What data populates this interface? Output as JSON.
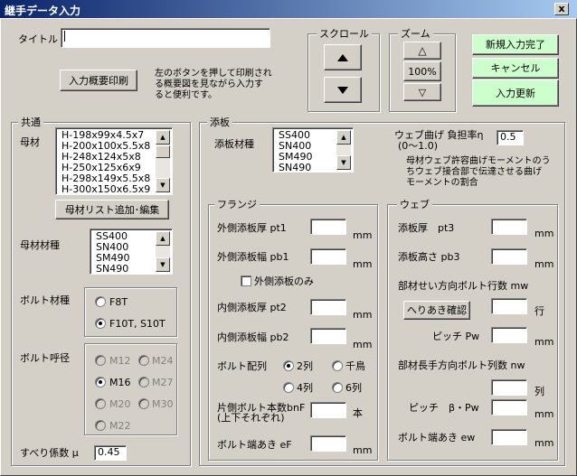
{
  "window": {
    "title": "継手データ入力",
    "close_glyph": "x"
  },
  "header": {
    "title_label": "タイトル",
    "title_value": "",
    "print_button": "入力概要印刷",
    "print_hint": [
      "左のボタンを押して印刷され",
      "る概要図を見ながら入力す",
      "ると便利です。"
    ]
  },
  "scroll": {
    "title": "スクロール",
    "up_icon": "arrow-up-icon",
    "down_icon": "arrow-down-icon"
  },
  "zoom": {
    "title": "ズーム",
    "zoom_in_glyph": "△",
    "level": "100%",
    "zoom_out_glyph": "▽"
  },
  "actions": {
    "new_complete": "新規入力完了",
    "cancel": "キャンセル",
    "update": "入力更新",
    "accent": "#ccffcc"
  },
  "common": {
    "title": "共通",
    "base_label": "母材",
    "base_items": [
      "H-198x99x4.5x7",
      "H-200x100x5.5x8",
      "H-248x124x5x8",
      "H-250x125x6x9",
      "H-298x149x5.5x8",
      "H-300x150x6.5x9"
    ],
    "base_edit_button": "母材リスト追加･編集",
    "base_material_label": "母材材種",
    "base_material_items": [
      "SS400",
      "SN400",
      "SM490",
      "SN490"
    ],
    "bolt_material_label": "ボルト材種",
    "bolt_material_options": [
      "F8T",
      "F10T, S10T"
    ],
    "bolt_size_label": "ボルト呼径",
    "bolt_size_options": [
      "M12",
      "M24",
      "M16",
      "M27",
      "M20",
      "M30",
      "M22"
    ],
    "slip_label": "すべり係数 μ",
    "slip_value": "0.45"
  },
  "plate": {
    "title": "添板",
    "material_label": "添板材種",
    "material_items": [
      "SS400",
      "SN400",
      "SM490",
      "SN490"
    ],
    "web_ratio_label": "ウェブ曲げ 負担率η",
    "web_ratio_range": "(0～1.0)",
    "web_ratio_value": "0.5",
    "web_ratio_note": [
      "母材ウェブ許容曲げモーメントのう",
      "ちウェブ接合部で伝達させる曲げ",
      "モーメントの割合"
    ],
    "flange": {
      "title": "フランジ",
      "outer_thickness": "外側添板厚 pt1",
      "outer_width": "外側添板幅 pb1",
      "outer_only": "外側添板のみ",
      "inner_thickness": "内側添板厚 pt2",
      "inner_width": "内側添板幅 pb2",
      "bolt_layout": "ボルト配列",
      "layout_options": [
        "2列",
        "千鳥",
        "4列",
        "6列"
      ],
      "bolt_count_1": "片側ボルト本数bnF",
      "bolt_count_2": "(上下それぞれ)",
      "bolt_count_unit": "本",
      "edge": "ボルト端あき eF",
      "unit_mm": "mm"
    },
    "web": {
      "title": "ウェブ",
      "thickness": "添板厚　pt3",
      "height": "添板高さ pb3",
      "rows_label": "部材せい方向ボルト行数 mw",
      "edge_check_button": "へりあき確認",
      "rows_unit": "行",
      "pitch_pw": "ピッチ Pw",
      "cols_label": "部材長手方向ボルト列数 nw",
      "cols_unit": "列",
      "pitch_beta": "ピッチ　β・Pw",
      "edge_ew": "ボルト端あき ew",
      "unit_mm": "mm"
    }
  }
}
